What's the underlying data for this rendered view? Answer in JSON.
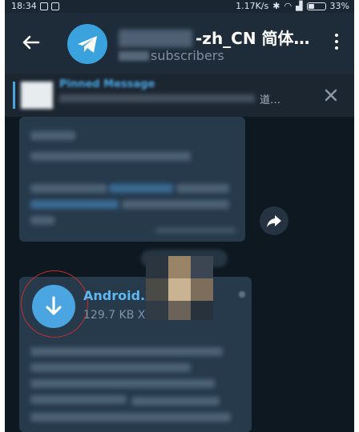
{
  "status_bar": {
    "time": "18:34",
    "network_speed": "1.17K/s",
    "battery": "33%",
    "battery_level": 0.33
  },
  "header": {
    "channel_title": "-zh_CN 简体…",
    "subscribers": "subscribers",
    "avatar_icon": "telegram-paper-plane-icon"
  },
  "pinned": {
    "label": "Pinned Message",
    "text": "道…"
  },
  "file_message": {
    "name": "Android.x",
    "size": "129.7 KB XML",
    "icon": "download-arrow-icon"
  },
  "colors": {
    "accent": "#4aa5e0",
    "header_bg": "#1e2c3a",
    "chat_bg": "#0e1821",
    "bubble_bg": "#263a4c",
    "highlight_ring": "#c42d2d"
  }
}
